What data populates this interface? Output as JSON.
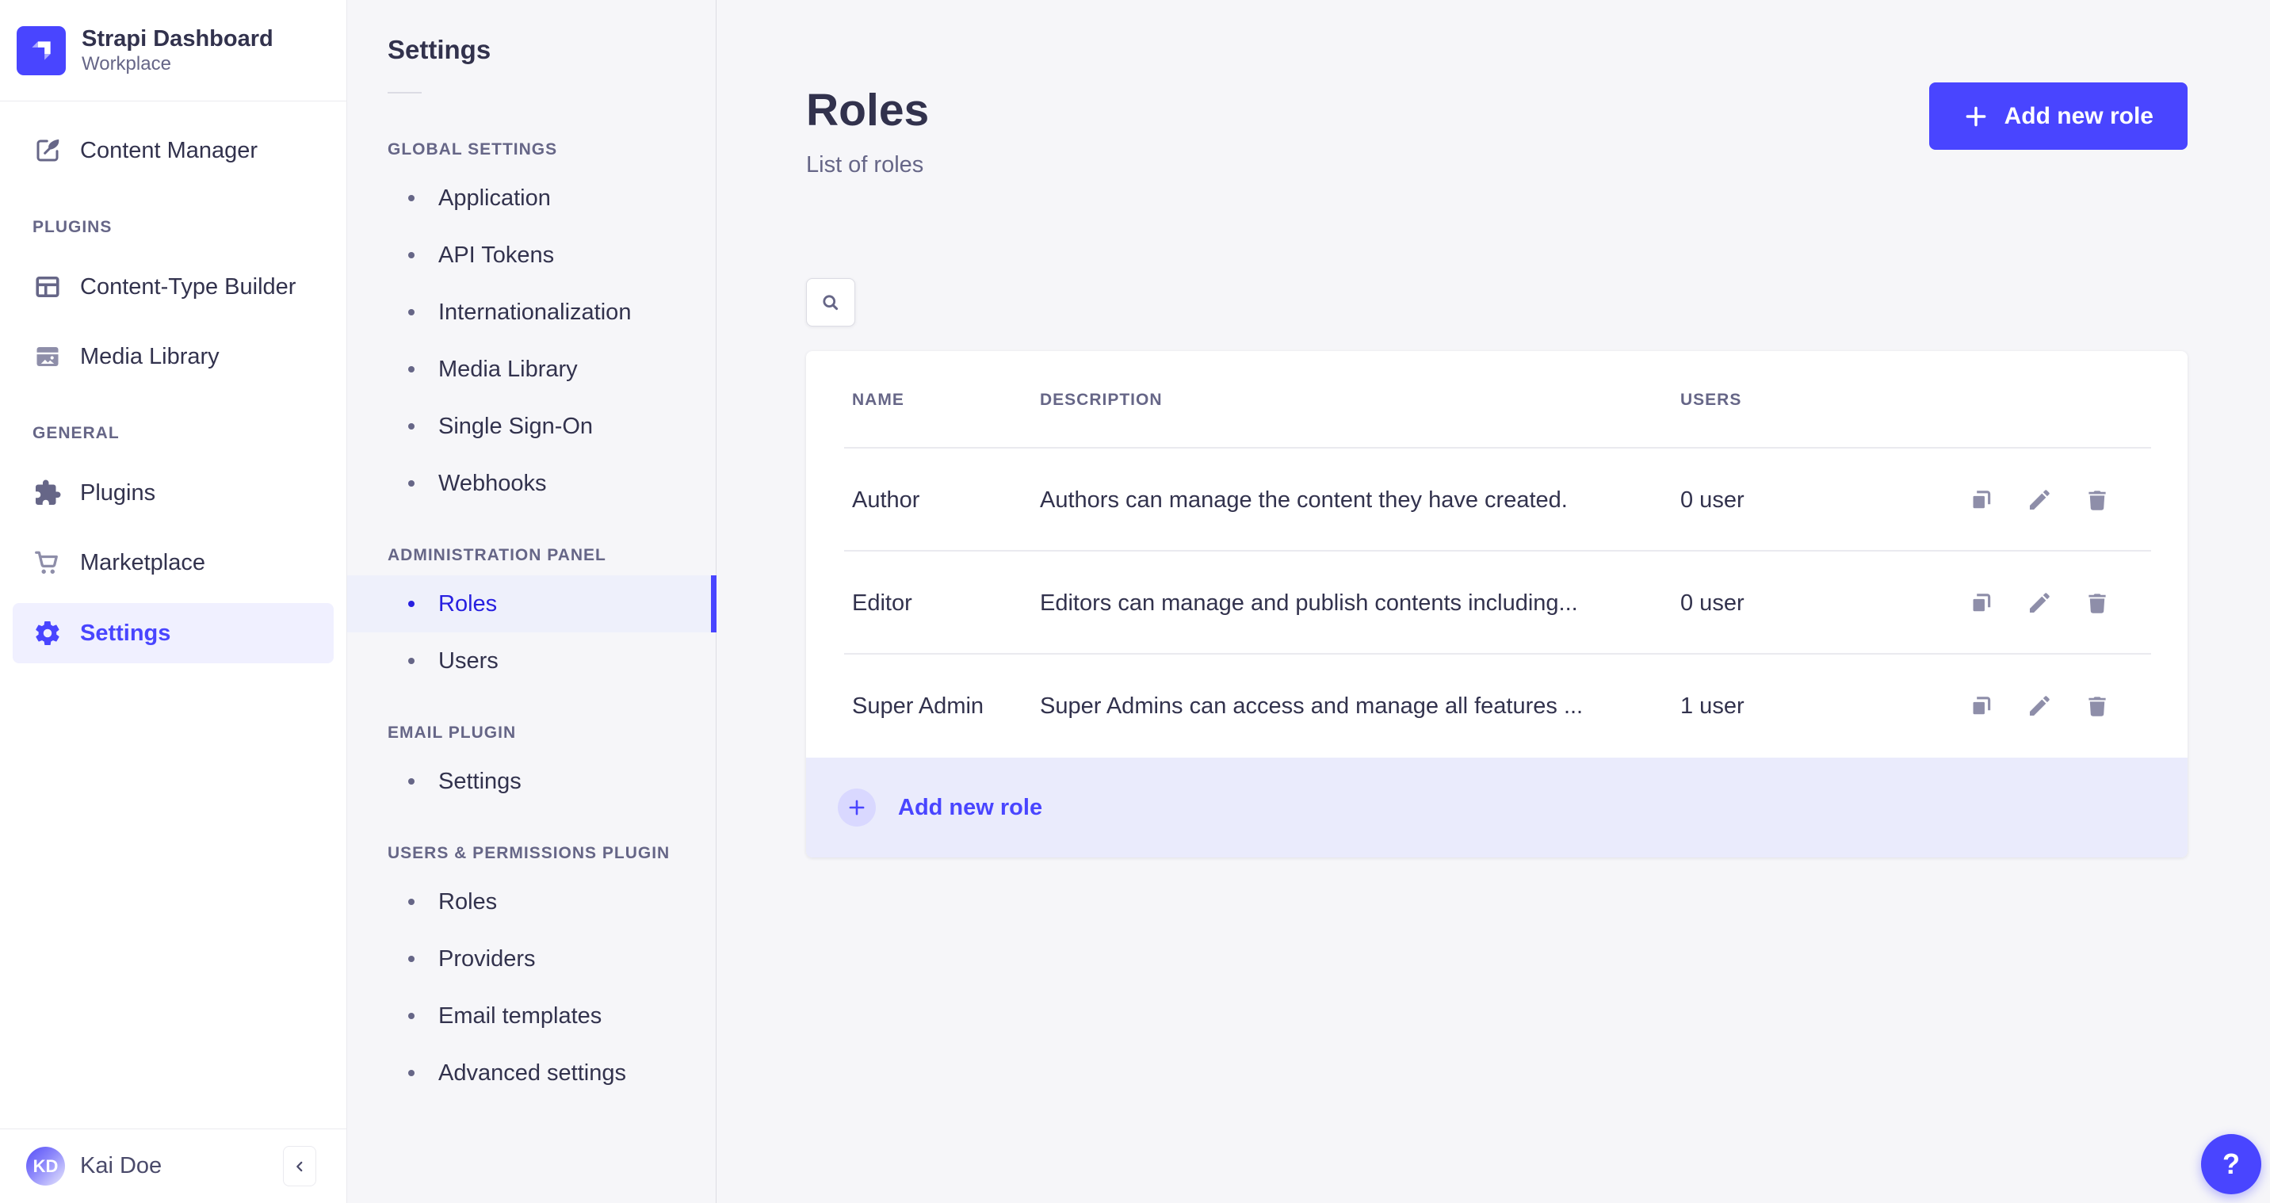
{
  "brand": {
    "app_name": "Strapi Dashboard",
    "workspace": "Workplace",
    "logo_icon": "strapi-logo-icon"
  },
  "main_nav": {
    "top_items": [
      {
        "label": "Content Manager",
        "icon": "feather-icon",
        "active": false
      }
    ],
    "sections": [
      {
        "label": "PLUGINS",
        "items": [
          {
            "label": "Content-Type Builder",
            "icon": "layout-grid-icon",
            "active": false
          },
          {
            "label": "Media Library",
            "icon": "image-icon",
            "active": false
          }
        ]
      },
      {
        "label": "GENERAL",
        "items": [
          {
            "label": "Plugins",
            "icon": "puzzle-icon",
            "active": false
          },
          {
            "label": "Marketplace",
            "icon": "cart-icon",
            "active": false
          },
          {
            "label": "Settings",
            "icon": "gear-icon",
            "active": true
          }
        ]
      }
    ]
  },
  "user": {
    "initials": "KD",
    "name": "Kai Doe"
  },
  "subnav": {
    "title": "Settings",
    "sections": [
      {
        "label": "GLOBAL SETTINGS",
        "items": [
          {
            "label": "Application",
            "active": false
          },
          {
            "label": "API Tokens",
            "active": false
          },
          {
            "label": "Internationalization",
            "active": false
          },
          {
            "label": "Media Library",
            "active": false
          },
          {
            "label": "Single Sign-On",
            "active": false
          },
          {
            "label": "Webhooks",
            "active": false
          }
        ]
      },
      {
        "label": "ADMINISTRATION PANEL",
        "items": [
          {
            "label": "Roles",
            "active": true
          },
          {
            "label": "Users",
            "active": false
          }
        ]
      },
      {
        "label": "EMAIL PLUGIN",
        "items": [
          {
            "label": "Settings",
            "active": false
          }
        ]
      },
      {
        "label": "USERS & PERMISSIONS PLUGIN",
        "items": [
          {
            "label": "Roles",
            "active": false
          },
          {
            "label": "Providers",
            "active": false
          },
          {
            "label": "Email templates",
            "active": false
          },
          {
            "label": "Advanced settings",
            "active": false
          }
        ]
      }
    ]
  },
  "page": {
    "title": "Roles",
    "subtitle": "List of roles",
    "add_button_label": "Add new role"
  },
  "table": {
    "headers": {
      "name": "NAME",
      "description": "DESCRIPTION",
      "users": "USERS"
    },
    "rows": [
      {
        "name": "Author",
        "description": "Authors can manage the content they have created.",
        "users": "0 user"
      },
      {
        "name": "Editor",
        "description": "Editors can manage and publish contents including...",
        "users": "0 user"
      },
      {
        "name": "Super Admin",
        "description": "Super Admins can access and manage all features ...",
        "users": "1 user"
      }
    ],
    "row_actions": [
      "duplicate-icon",
      "edit-icon",
      "delete-icon"
    ],
    "footer_action_label": "Add new role"
  },
  "help": {
    "label": "?"
  },
  "colors": {
    "primary": "#4945ff",
    "primary_dark": "#271fe0",
    "primary_light": "#f0f0ff",
    "primary_badge": "#d9d8ff",
    "background": "#f6f6f9",
    "card": "#ffffff",
    "border": "#eaeaef",
    "text": "#32324d",
    "text_muted": "#666687",
    "icon_muted": "#8e8ea9"
  }
}
